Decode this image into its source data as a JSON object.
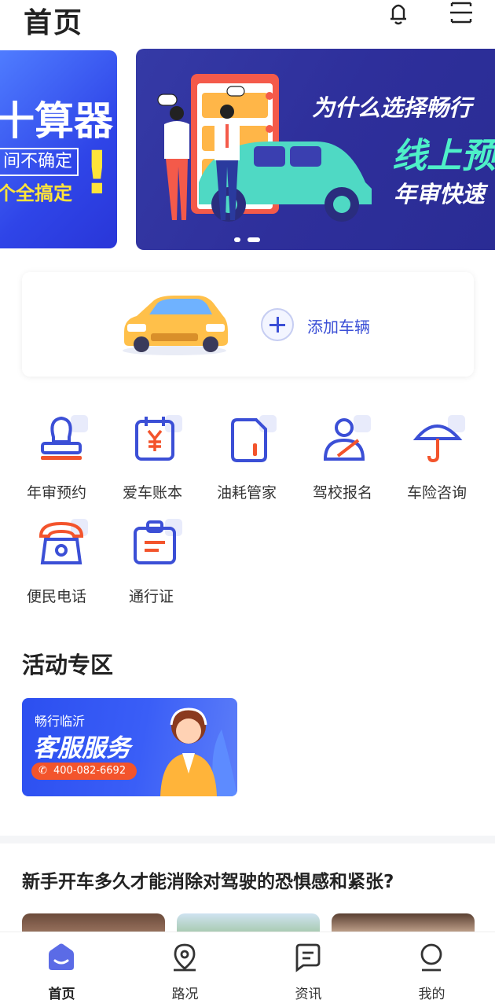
{
  "header": {
    "title": "首页",
    "bell_icon": "bell-icon",
    "scan_icon": "scan-icon"
  },
  "carousel": {
    "left_slide": {
      "big_text": "十算器",
      "boxed_text": "间不确定",
      "yellow_text": "个全搞定",
      "exclaim": "!"
    },
    "main_slide": {
      "line1": "为什么选择畅行",
      "line2": "线上预",
      "line3": "年审快速"
    }
  },
  "add_vehicle": {
    "label": "添加车辆",
    "plus_icon": "plus-icon"
  },
  "services": [
    {
      "label": "年审预约",
      "icon": "stamp-icon"
    },
    {
      "label": "爱车账本",
      "icon": "ledger-icon"
    },
    {
      "label": "油耗管家",
      "icon": "fuel-card-icon"
    },
    {
      "label": "驾校报名",
      "icon": "driver-icon"
    },
    {
      "label": "车险咨询",
      "icon": "umbrella-icon"
    },
    {
      "label": "便民电话",
      "icon": "telephone-icon"
    },
    {
      "label": "通行证",
      "icon": "clipboard-icon"
    }
  ],
  "activity": {
    "title": "活动专区",
    "promo": {
      "subtitle": "畅行临沂",
      "title": "客服服务",
      "phone": "400-082-6692"
    }
  },
  "article": {
    "title": "新手开车多久才能消除对驾驶的恐惧感和紧张?"
  },
  "tabbar": {
    "items": [
      {
        "label": "首页",
        "icon": "home-icon",
        "active": true
      },
      {
        "label": "路况",
        "icon": "location-icon",
        "active": false
      },
      {
        "label": "资讯",
        "icon": "message-icon",
        "active": false
      },
      {
        "label": "我的",
        "icon": "profile-icon",
        "active": false
      }
    ]
  },
  "colors": {
    "brand_blue": "#3b4fd6",
    "accent_orange": "#f3542c",
    "teal": "#4ef0c8"
  }
}
